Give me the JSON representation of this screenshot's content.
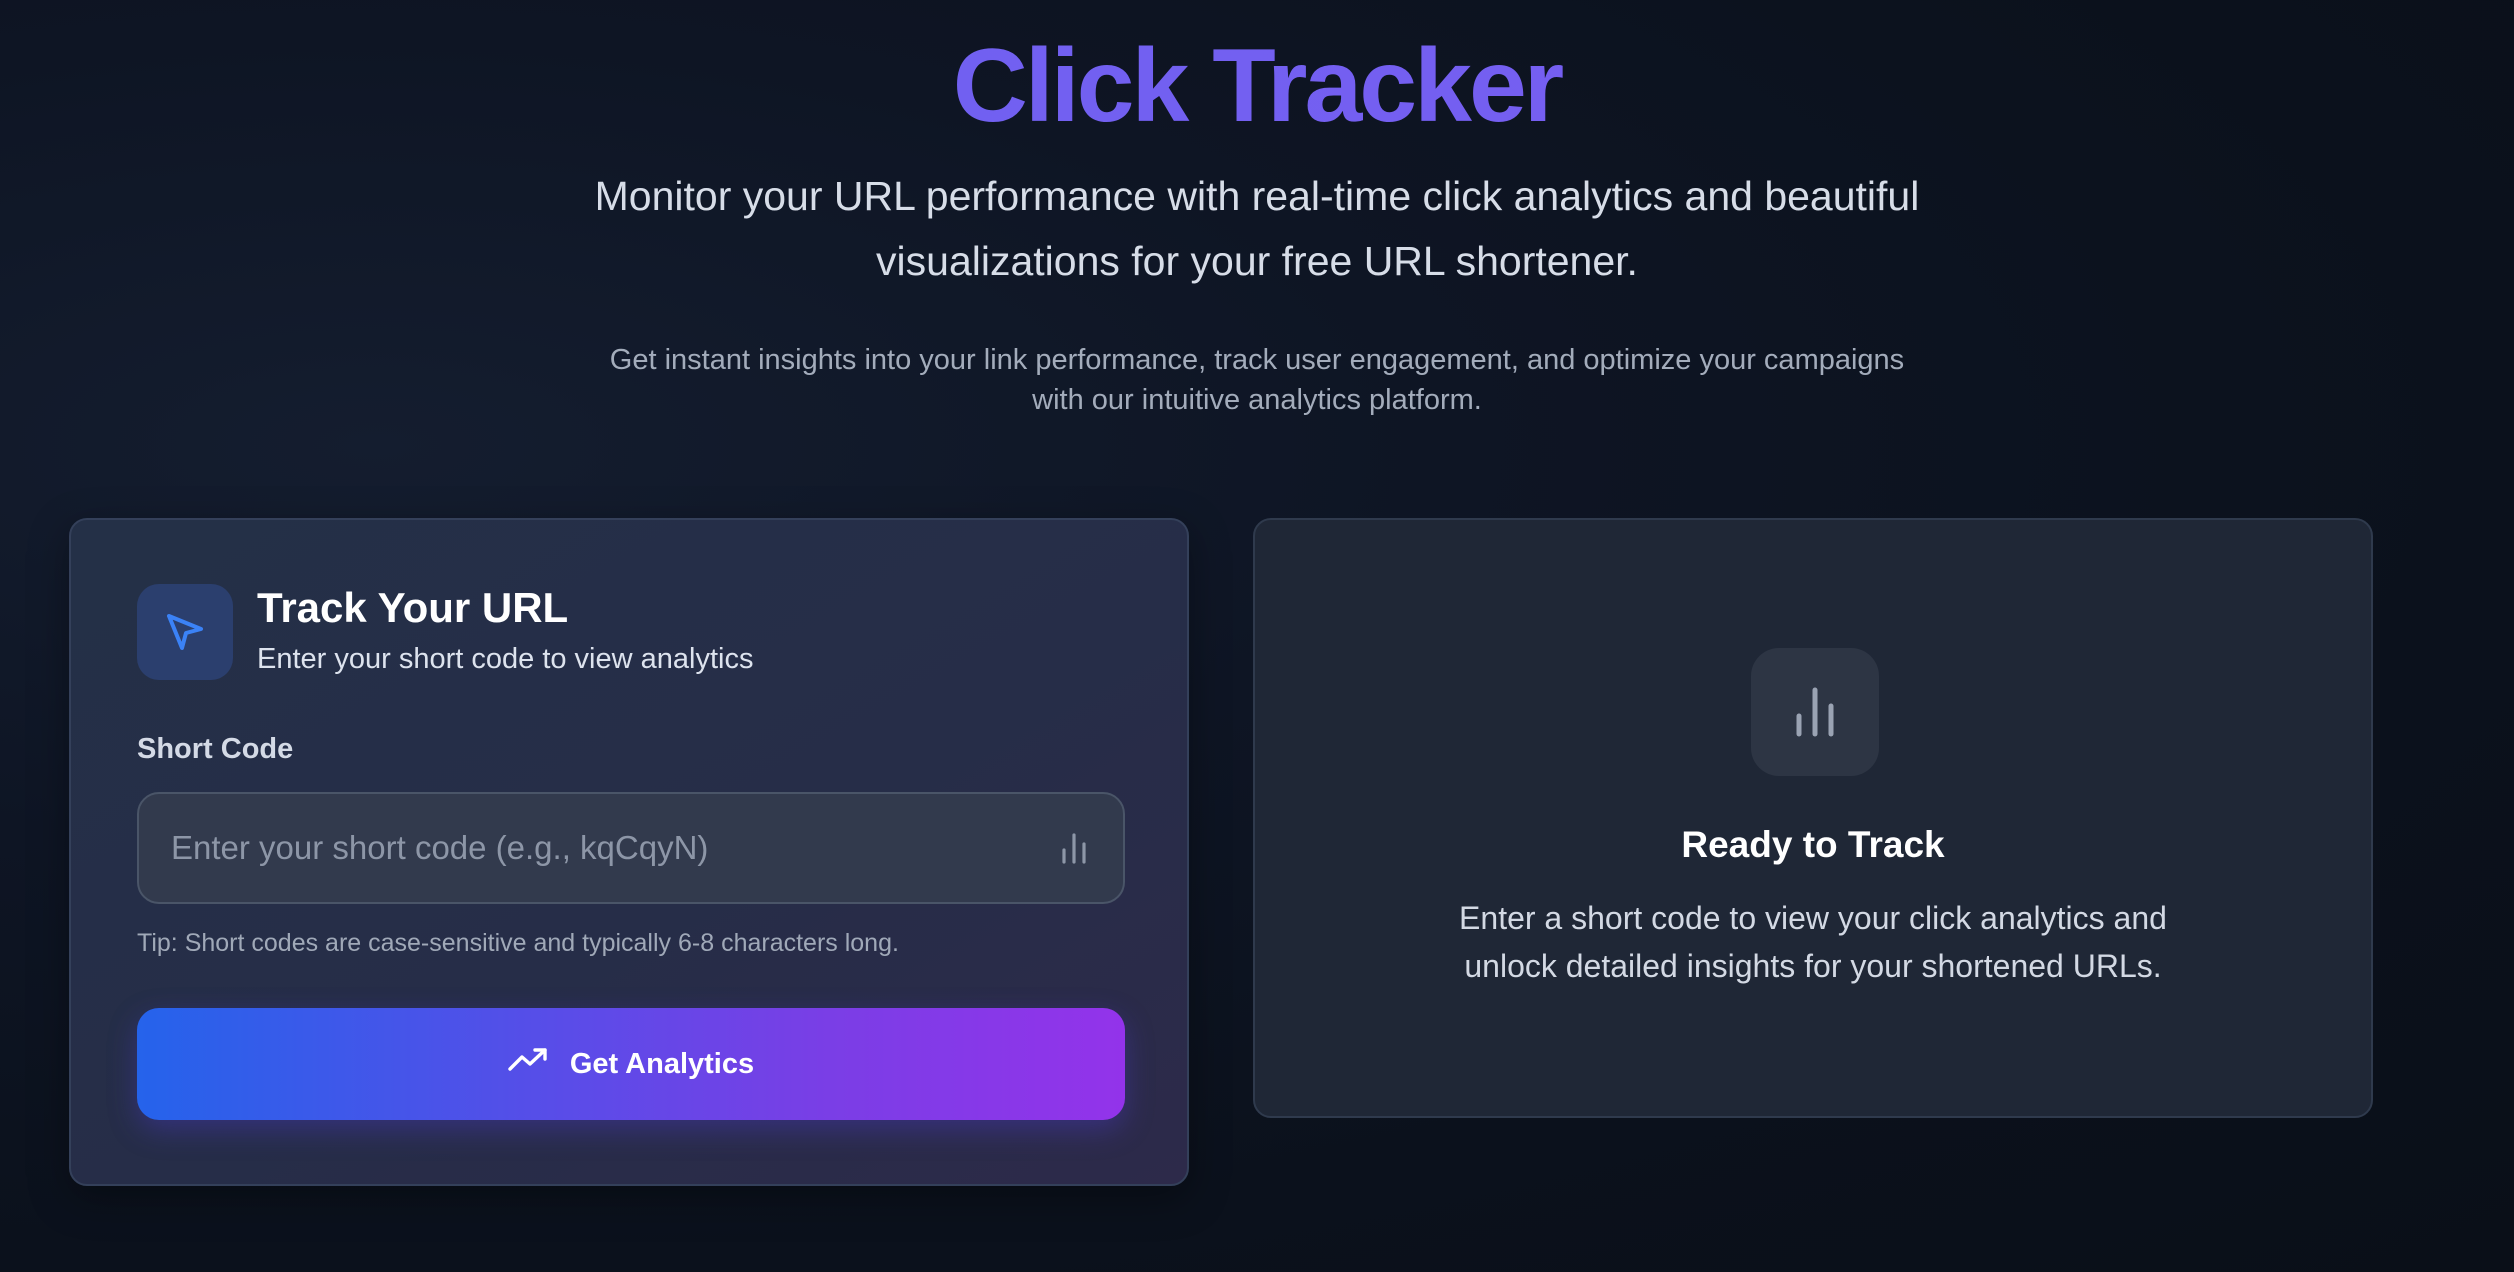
{
  "hero": {
    "title": "Click Tracker",
    "subtitle": "Monitor your URL performance with real-time click analytics and beautiful visualizations for your free URL shortener.",
    "description": "Get instant insights into your link performance, track user engagement, and optimize your campaigns with our intuitive analytics platform."
  },
  "track_card": {
    "icon": "cursor-arrow-icon",
    "title": "Track Your URL",
    "subtitle": "Enter your short code to view analytics",
    "field_label": "Short Code",
    "input": {
      "value": "",
      "placeholder": "Enter your short code (e.g., kqCqyN)",
      "icon": "bar-chart-icon"
    },
    "tip": "Tip: Short codes are case-sensitive and typically 6-8 characters long.",
    "button": {
      "label": "Get Analytics",
      "icon": "trending-up-icon"
    }
  },
  "ready_card": {
    "icon": "bar-chart-icon",
    "title": "Ready to Track",
    "description": "Enter a short code to view your click analytics and unlock detailed insights for your shortened URLs."
  },
  "colors": {
    "title_accent": "#6b63f2",
    "button_gradient_start": "#2563eb",
    "button_gradient_end": "#9333ea",
    "icon_blue": "#3b82f6"
  }
}
